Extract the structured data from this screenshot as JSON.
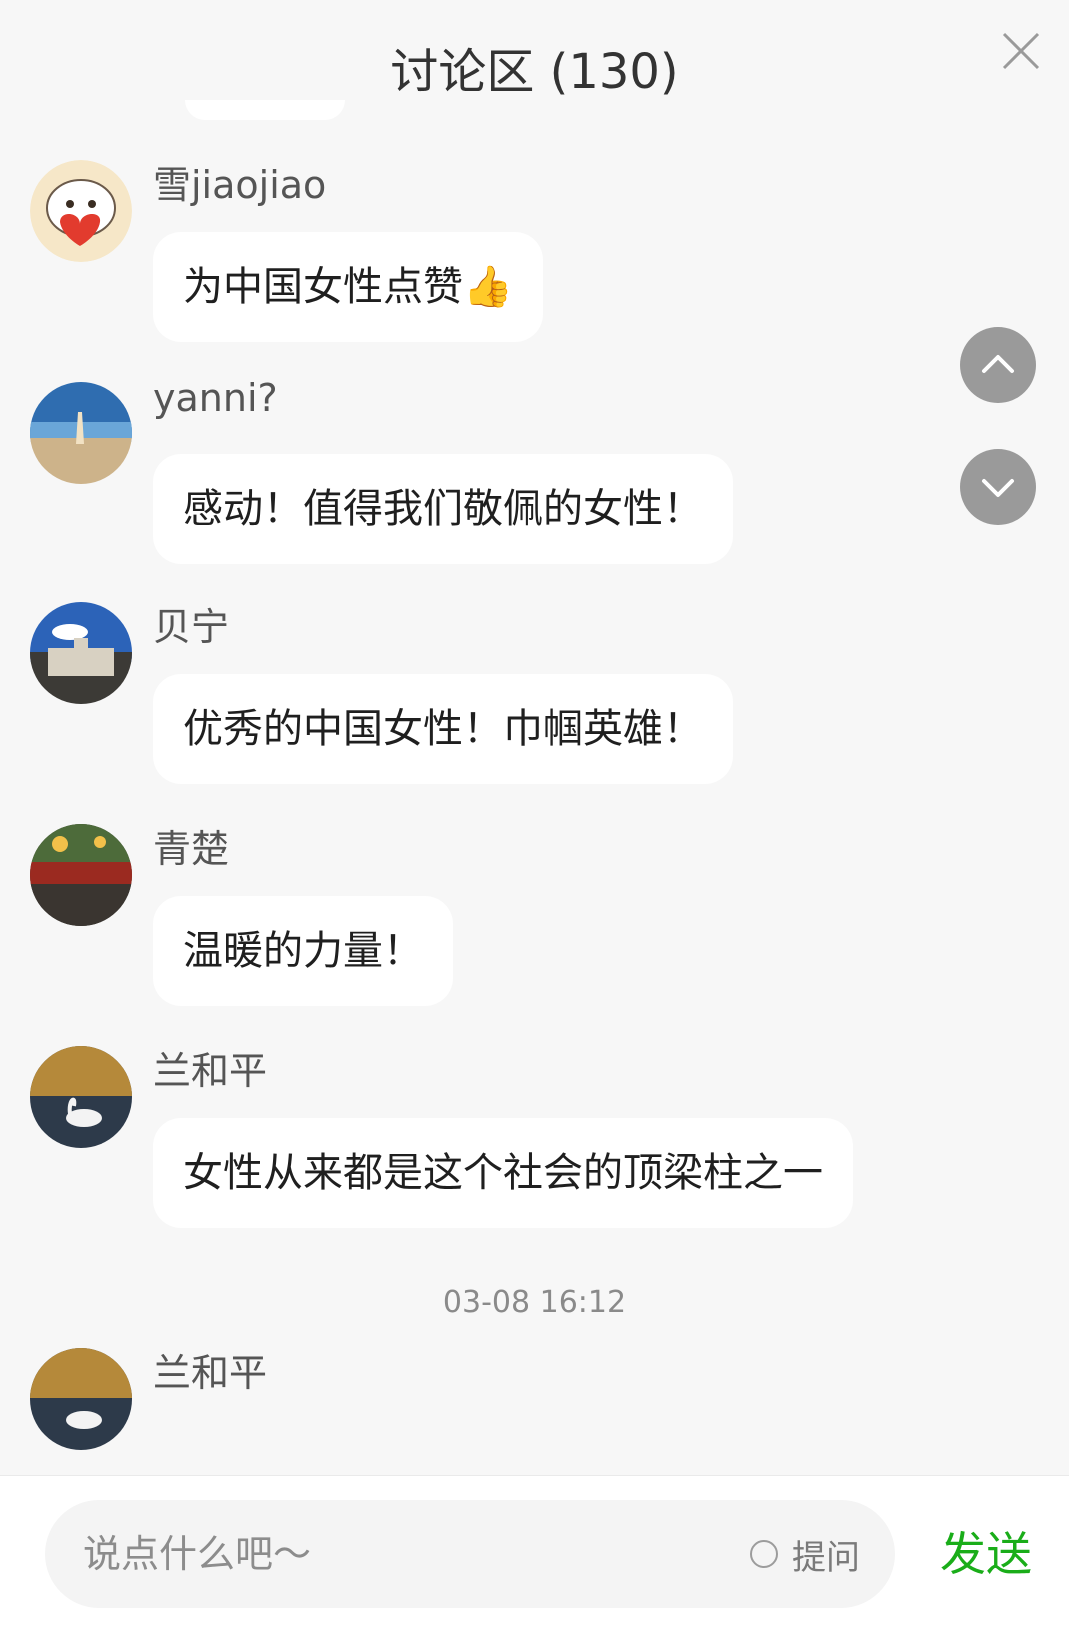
{
  "header": {
    "title": "讨论区 (130)"
  },
  "messages": [
    {
      "username": "雪jiaojiao",
      "text": "为中国女性点赞👍"
    },
    {
      "username": "yanni?",
      "text": "感动！值得我们敬佩的女性！"
    },
    {
      "username": "贝宁",
      "text": "优秀的中国女性！巾帼英雄！"
    },
    {
      "username": "青楚",
      "text": "温暖的力量！"
    },
    {
      "username": "兰和平",
      "text": "女性从来都是这个社会的顶梁柱之一"
    }
  ],
  "timestamp": "03-08 16:12",
  "last_message": {
    "username": "兰和平"
  },
  "input": {
    "placeholder": "说点什么吧～",
    "ask_label": "提问",
    "send_label": "发送"
  },
  "colors": {
    "send": "#1aad19",
    "bubble": "#ffffff",
    "background": "#f7f7f7"
  }
}
